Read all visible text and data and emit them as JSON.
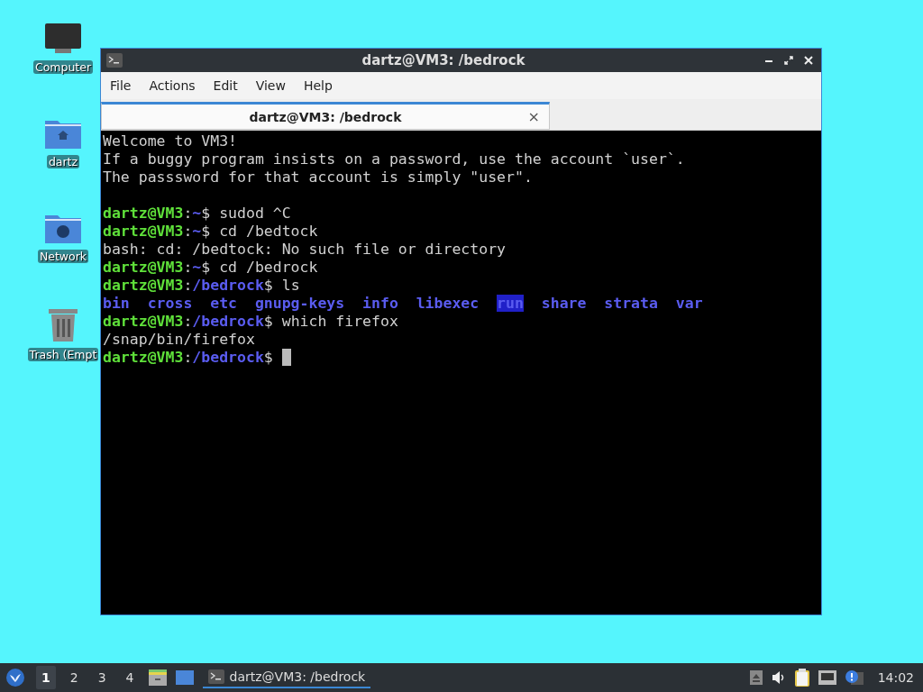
{
  "desktop_icons": [
    {
      "kind": "computer",
      "label": "Computer"
    },
    {
      "kind": "home",
      "label": "dartz"
    },
    {
      "kind": "network",
      "label": "Network"
    },
    {
      "kind": "trash",
      "label": "Trash (Empt"
    }
  ],
  "window": {
    "title": "dartz@VM3: /bedrock",
    "menu": [
      "File",
      "Actions",
      "Edit",
      "View",
      "Help"
    ],
    "tabs": [
      {
        "label": "dartz@VM3: /bedrock",
        "selected": true,
        "close": "×"
      }
    ],
    "terminal": {
      "lines": [
        [
          {
            "kind": "plain",
            "text": "Welcome to VM3!"
          }
        ],
        [
          {
            "kind": "plain",
            "text": "If a buggy program insists on a password, use the account `user`."
          }
        ],
        [
          {
            "kind": "plain",
            "text": "The passsword for that account is simply \"user\"."
          }
        ],
        [
          {
            "kind": "blank"
          }
        ],
        [
          {
            "kind": "user",
            "text": "dartz@VM3"
          },
          {
            "kind": "plain",
            "text": ":"
          },
          {
            "kind": "path",
            "text": "~"
          },
          {
            "kind": "plain",
            "text": "$ sudod ^C"
          }
        ],
        [
          {
            "kind": "user",
            "text": "dartz@VM3"
          },
          {
            "kind": "plain",
            "text": ":"
          },
          {
            "kind": "path",
            "text": "~"
          },
          {
            "kind": "plain",
            "text": "$ cd /bedtock"
          }
        ],
        [
          {
            "kind": "plain",
            "text": "bash: cd: /bedtock: No such file or directory"
          }
        ],
        [
          {
            "kind": "user",
            "text": "dartz@VM3"
          },
          {
            "kind": "plain",
            "text": ":"
          },
          {
            "kind": "path",
            "text": "~"
          },
          {
            "kind": "plain",
            "text": "$ cd /bedrock"
          }
        ],
        [
          {
            "kind": "user",
            "text": "dartz@VM3"
          },
          {
            "kind": "plain",
            "text": ":"
          },
          {
            "kind": "path",
            "text": "/bedrock"
          },
          {
            "kind": "plain",
            "text": "$ ls"
          }
        ],
        [
          {
            "kind": "dir",
            "text": "bin"
          },
          {
            "kind": "dir",
            "text": "cross"
          },
          {
            "kind": "dir",
            "text": "etc"
          },
          {
            "kind": "dir",
            "text": "gnupg-keys"
          },
          {
            "kind": "dir",
            "text": "info"
          },
          {
            "kind": "dir",
            "text": "libexec"
          },
          {
            "kind": "dir_marked",
            "text": "run"
          },
          {
            "kind": "dir",
            "text": "share"
          },
          {
            "kind": "dir",
            "text": "strata"
          },
          {
            "kind": "dir",
            "text": "var"
          }
        ],
        [
          {
            "kind": "user",
            "text": "dartz@VM3"
          },
          {
            "kind": "plain",
            "text": ":"
          },
          {
            "kind": "path",
            "text": "/bedrock"
          },
          {
            "kind": "plain",
            "text": "$ which firefox"
          }
        ],
        [
          {
            "kind": "plain",
            "text": "/snap/bin/firefox"
          }
        ],
        [
          {
            "kind": "user",
            "text": "dartz@VM3"
          },
          {
            "kind": "plain",
            "text": ":"
          },
          {
            "kind": "path",
            "text": "/bedrock"
          },
          {
            "kind": "plain",
            "text": "$"
          },
          {
            "kind": "cursor"
          }
        ]
      ]
    }
  },
  "taskbar": {
    "workspaces": [
      {
        "label": "1",
        "selected": true
      },
      {
        "label": "2",
        "selected": false
      },
      {
        "label": "3",
        "selected": false
      },
      {
        "label": "4",
        "selected": false
      }
    ],
    "tasks": [
      {
        "label": "dartz@VM3: /bedrock",
        "selected": true
      }
    ],
    "clock": "14:02"
  }
}
